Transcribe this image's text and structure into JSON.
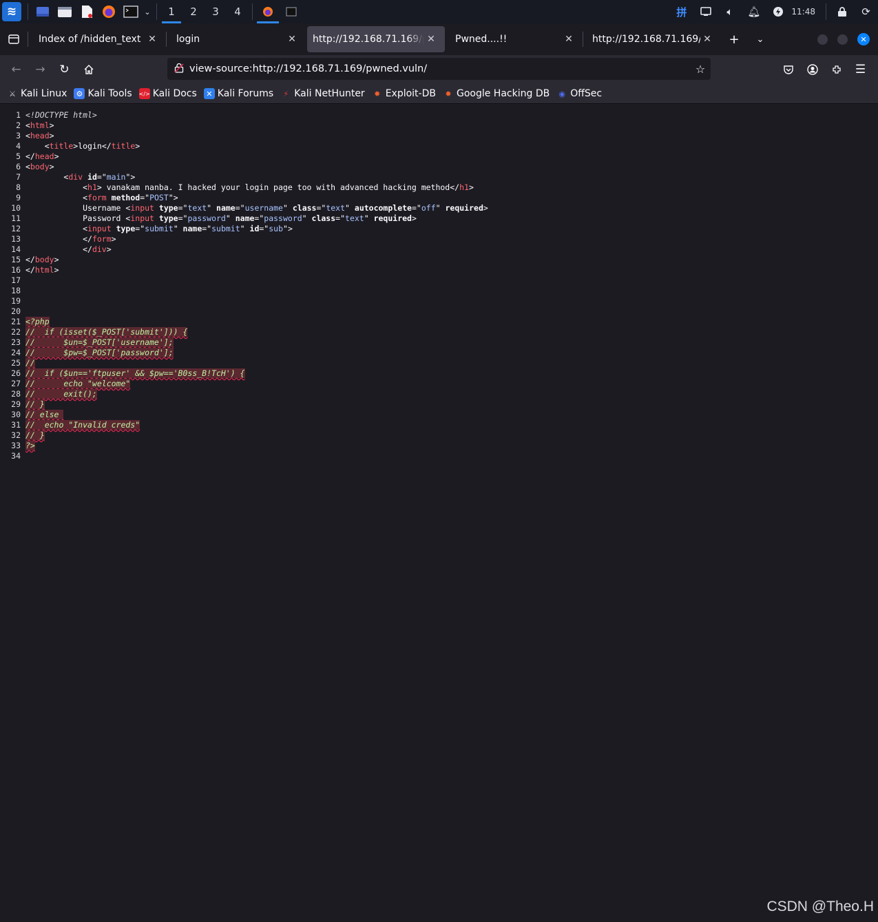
{
  "taskbar": {
    "workspaces": [
      "1",
      "2",
      "3",
      "4"
    ],
    "active_workspace": 0,
    "clock": "11:48",
    "input_method": "拼"
  },
  "tabs": [
    {
      "title": "Index of /hidden_text",
      "selected": false
    },
    {
      "title": "login",
      "selected": false
    },
    {
      "title": "http://192.168.71.169/pwned.vuln/",
      "selected": true
    },
    {
      "title": "Pwned....!!",
      "selected": false
    },
    {
      "title": "http://192.168.71.169/",
      "selected": false
    }
  ],
  "urlbar": {
    "url": "view-source:http://192.168.71.169/pwned.vuln/"
  },
  "bookmarks": [
    {
      "label": "Kali Linux",
      "icon": "kali-dragon-icon",
      "color": "#cfd3dc"
    },
    {
      "label": "Kali Tools",
      "icon": "kali-tools-icon",
      "color": "#3d7bf0"
    },
    {
      "label": "Kali Docs",
      "icon": "kali-docs-icon",
      "color": "#e0202e"
    },
    {
      "label": "Kali Forums",
      "icon": "kali-forums-icon",
      "color": "#2f80ed"
    },
    {
      "label": "Kali NetHunter",
      "icon": "nethunter-icon",
      "color": "#e03a3a"
    },
    {
      "label": "Exploit-DB",
      "icon": "exploit-db-icon",
      "color": "#f0602a"
    },
    {
      "label": "Google Hacking DB",
      "icon": "ghdb-icon",
      "color": "#f0602a"
    },
    {
      "label": "OffSec",
      "icon": "offsec-icon",
      "color": "#4c6cf0"
    }
  ],
  "source_lines": [
    "1",
    "2",
    "3",
    "4",
    "5",
    "6",
    "7",
    "8",
    "9",
    "10",
    "11",
    "12",
    "13",
    "14",
    "15",
    "16",
    "17",
    "18",
    "19",
    "20",
    "21",
    "22",
    "23",
    "24",
    "25",
    "26",
    "27",
    "28",
    "29",
    "30",
    "31",
    "32",
    "33",
    "34"
  ],
  "source_text": {
    "doctype": "<!DOCTYPE html>",
    "h1_text": " vanakam nanba. I hacked your login page too with advanced hacking method",
    "title_text": "login",
    "username_label": "Username ",
    "password_label": "Password ",
    "php": [
      "<?php",
      "//  if (isset($_POST['submit'])) {",
      "//      $un=$_POST['username'];",
      "//      $pw=$_POST['password'];",
      "//",
      "//  if ($un=='ftpuser' && $pw=='B0ss_B!TcH') {",
      "//      echo \"welcome\"",
      "//      exit();",
      "// }",
      "// else ",
      "//  echo \"Invalid creds\"",
      "// }",
      "?>"
    ]
  },
  "watermark": "CSDN @Theo.H"
}
